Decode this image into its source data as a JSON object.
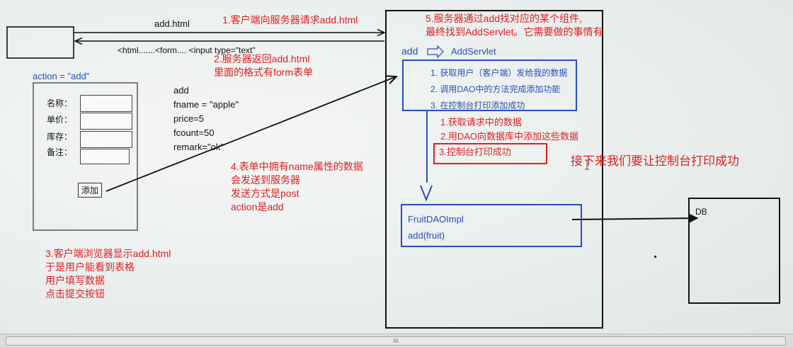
{
  "client": {
    "action_label": "action = \"add\"",
    "form_fields": [
      {
        "label": "名称："
      },
      {
        "label": "单价："
      },
      {
        "label": "库存："
      },
      {
        "label": "备注："
      }
    ],
    "submit_label": "添加"
  },
  "request": {
    "url_label": "add.html",
    "response_label": "<html.......<form.... <input type=\"text\"",
    "form_params": [
      "add",
      "fname = \"apple\"",
      "price=5",
      "fcount=50",
      "remark=\"ok\""
    ]
  },
  "steps": {
    "step1": "1.客户端向服务器请求add.html",
    "step2": [
      "2.服务器返回add.html",
      "里面的格式有form表单"
    ],
    "step3": [
      "3.客户端浏览器显示add.html",
      "于是用户能看到表格",
      "用户填写数据",
      "点击提交按钮"
    ],
    "step4": [
      "4.表单中拥有name属性的数据",
      "会发送到服务器",
      "发送方式是post",
      "action是add"
    ],
    "step5": [
      "5.服务器通过add找对应的某个组件,",
      "最终找到AddServlet。它需要做的事情有"
    ]
  },
  "server": {
    "mapping_from": "add",
    "mapping_to": "AddServlet",
    "servlet_tasks": [
      "1. 获取用户（客户端）发给我的数据",
      "2. 调用DAO中的方法完成添加功能",
      "3. 在控制台打印添加成功"
    ],
    "red_tasks": [
      "1.获取请求中的数据",
      "2.用DAO向数据库中添加这些数据"
    ],
    "highlight_task": "3.控制台打印成功",
    "next_note": "接下来我们要让控制台打印成功",
    "dao_class": "FruitDAOImpl",
    "dao_method": "add(fruit)",
    "db_label": "DB"
  },
  "ui": {
    "scroll_grip": "III"
  }
}
